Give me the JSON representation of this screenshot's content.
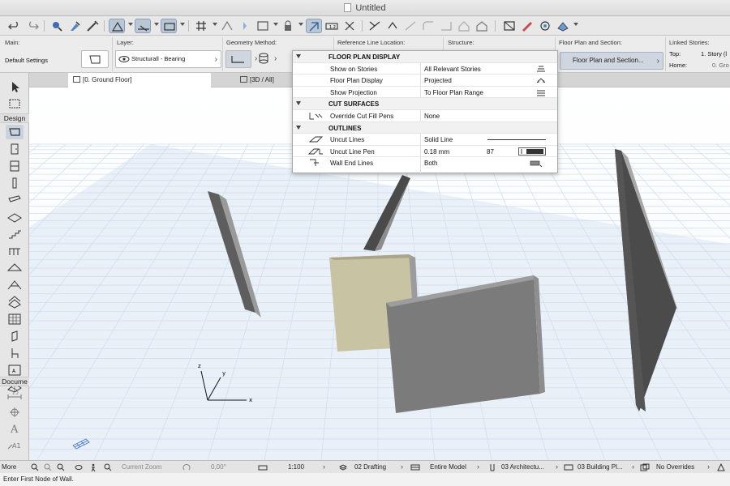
{
  "window": {
    "title": "Untitled"
  },
  "infobox": {
    "main_label": "Main:",
    "main_value": "Default Settings",
    "layer_label": "Layer:",
    "layer_value": "Structurall - Bearing",
    "geometry_label": "Geometry Method:",
    "reference_label": "Reference Line Location:",
    "structure_label": "Structure:",
    "fps_label": "Floor Plan and Section:",
    "fps_button": "Floor Plan and Section...",
    "linked_label": "Linked Stories:",
    "top_label": "Top:",
    "top_value": "1. Story (l",
    "home_label": "Home:",
    "home_value": "0. Gro"
  },
  "tabs": [
    {
      "label": "[0. Ground Floor]"
    },
    {
      "label": "[3D / All]"
    }
  ],
  "toolbox": {
    "design_label": "Design",
    "document_label": "Docume",
    "more_label": "More"
  },
  "popup": {
    "sections": [
      {
        "title": "FLOOR PLAN DISPLAY",
        "rows": [
          {
            "key": "Show on Stories",
            "value": "All Relevant Stories"
          },
          {
            "key": "Floor Plan Display",
            "value": "Projected"
          },
          {
            "key": "Show Projection",
            "value": "To Floor Plan Range"
          }
        ]
      },
      {
        "title": "CUT SURFACES",
        "rows": [
          {
            "key": "Override Cut Fill Pens",
            "value": "None"
          }
        ]
      },
      {
        "title": "OUTLINES",
        "rows": [
          {
            "key": "Uncut Lines",
            "value": "Solid Line"
          },
          {
            "key": "Uncut Line Pen",
            "value": "0.18 mm",
            "pen": "87"
          },
          {
            "key": "Wall End Lines",
            "value": "Both"
          }
        ]
      }
    ]
  },
  "axes": {
    "x": "x",
    "y": "y",
    "z": "z"
  },
  "statusbar": {
    "zoom": "Current Zoom",
    "angle": "0,00°",
    "scale": "1:100",
    "drafting": "02 Drafting",
    "model": "Entire Model",
    "architecture": "03 Architectu...",
    "building": "03 Building Pl...",
    "overrides": "No Overrides"
  },
  "prompt": "Enter First Node of Wall.",
  "colors": {
    "accent": "#b8c6d6",
    "grid_line": "#cfdcec",
    "wall_dark": "#5a5a5a",
    "wall_face": "#7b7b7b",
    "wall_beige": "#c8c3a2"
  }
}
